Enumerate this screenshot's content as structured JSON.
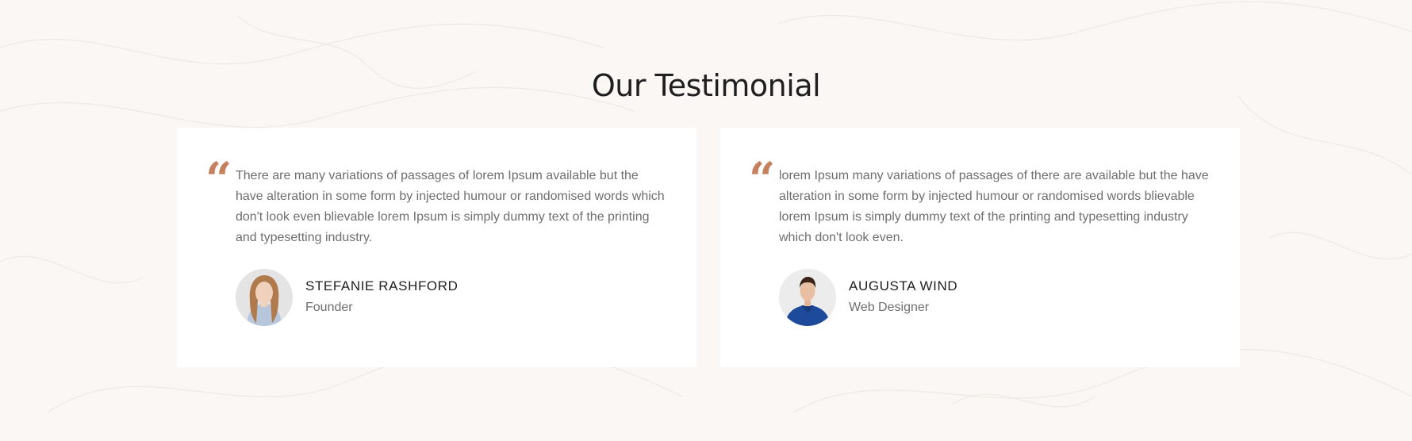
{
  "section": {
    "title": "Our Testimonial"
  },
  "colors": {
    "accent": "#c4805f",
    "background": "#faf7f4",
    "card": "#ffffff",
    "text": "#6e6e6e",
    "heading": "#1f1f1f"
  },
  "testimonials": [
    {
      "quote_icon": "quote-left-icon",
      "text": "There are many variations of passages of lorem Ipsum available but the have alteration in some form by injected humour or randomised words which don't look even blievable lorem Ipsum is simply dummy text of the printing and typesetting industry.",
      "name": "STEFANIE RASHFORD",
      "role": "Founder"
    },
    {
      "quote_icon": "quote-left-icon",
      "text": "lorem Ipsum many variations of passages of there are available but the have alteration in some form by injected humour or randomised words blievable lorem Ipsum is simply dummy text of the printing and typesetting industry which don't look even.",
      "name": "AUGUSTA WIND",
      "role": "Web Designer"
    }
  ]
}
